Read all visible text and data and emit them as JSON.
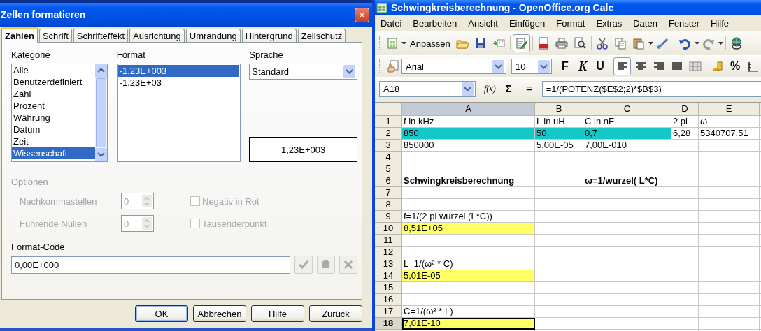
{
  "dialog": {
    "title": "Zellen formatieren",
    "tabs": [
      {
        "label": "Zahlen",
        "selected": true
      },
      {
        "label": "Schrift",
        "selected": false
      },
      {
        "label": "Schrifteffekt",
        "selected": false
      },
      {
        "label": "Ausrichtung",
        "selected": false
      },
      {
        "label": "Umrandung",
        "selected": false
      },
      {
        "label": "Hintergrund",
        "selected": false
      },
      {
        "label": "Zellschutz",
        "selected": false
      }
    ],
    "category": {
      "label": "Kategorie",
      "items": [
        {
          "label": "Alle",
          "selected": false
        },
        {
          "label": "Benutzerdefiniert",
          "selected": false
        },
        {
          "label": "Zahl",
          "selected": false
        },
        {
          "label": "Prozent",
          "selected": false
        },
        {
          "label": "Währung",
          "selected": false
        },
        {
          "label": "Datum",
          "selected": false
        },
        {
          "label": "Zeit",
          "selected": false
        },
        {
          "label": "Wissenschaft",
          "selected": true
        }
      ]
    },
    "format": {
      "label": "Format",
      "items": [
        {
          "label": "-1,23E+003",
          "selected": true
        },
        {
          "label": "-1,23E+03",
          "selected": false
        }
      ]
    },
    "language": {
      "label": "Sprache",
      "value": "Standard"
    },
    "preview": "1,23E+003",
    "options": {
      "label": "Optionen",
      "disabled": true,
      "fields": [
        {
          "label": "Nachkommastellen",
          "value": "0"
        },
        {
          "label": "Führende Nullen",
          "value": "0"
        }
      ],
      "checkboxes": [
        {
          "label": "Negativ in Rot",
          "checked": false
        },
        {
          "label": "Tausenderpunkt",
          "checked": false
        }
      ]
    },
    "format_code": {
      "label": "Format-Code",
      "value": "0,00E+000"
    },
    "buttons": [
      {
        "label": "OK",
        "default": true
      },
      {
        "label": "Abbrechen",
        "default": false
      },
      {
        "label": "Hilfe",
        "default": false
      },
      {
        "label": "Zurück",
        "default": false
      }
    ]
  },
  "calc": {
    "title": "Schwingkreisberechnung - OpenOffice.org Calc",
    "menu": [
      "Datei",
      "Bearbeiten",
      "Ansicht",
      "Einfügen",
      "Format",
      "Extras",
      "Daten",
      "Fenster",
      "Hilfe"
    ],
    "toolbar": {
      "customize_label": "Anpassen",
      "edit_mode_on": true
    },
    "format_toolbar": {
      "font": "Arial",
      "size": "10",
      "bold_label": "F",
      "italic_label": "K",
      "underline_label": "U",
      "align_options": [
        {
          "selected": true
        },
        {
          "selected": false
        },
        {
          "selected": false
        },
        {
          "selected": false
        }
      ],
      "percent_label": "%"
    },
    "formula_bar": {
      "cell_ref": "A18",
      "function_label": "f(x)",
      "sum_label": "Σ",
      "equals_label": "=",
      "formula": "=1/(POTENZ($E$2;2)*$B$3)"
    },
    "sheet": {
      "columns": [
        {
          "label": "A",
          "selected": true
        },
        {
          "label": "B",
          "selected": false
        },
        {
          "label": "C",
          "selected": false
        },
        {
          "label": "D",
          "selected": false
        },
        {
          "label": "E",
          "selected": false
        }
      ],
      "rows": [
        {
          "label": "1",
          "selected": false,
          "cells": [
            {
              "text": "f in kHz"
            },
            {
              "text": "L in uH"
            },
            {
              "text": "C in nF"
            },
            {
              "text": "2 pi"
            },
            {
              "text": "ω"
            }
          ]
        },
        {
          "label": "2",
          "selected": false,
          "cells": [
            {
              "text": "850",
              "color": "#14c8c8"
            },
            {
              "text": "50",
              "color": "#14c8c8"
            },
            {
              "text": "0,7",
              "color": "#14c8c8"
            },
            {
              "text": "6,28"
            },
            {
              "text": "5340707,51"
            }
          ]
        },
        {
          "label": "3",
          "selected": false,
          "cells": [
            {
              "text": "850000"
            },
            {
              "text": "5,00E-05"
            },
            {
              "text": "7,00E-010"
            }
          ]
        },
        {
          "label": "4",
          "selected": false,
          "cells": []
        },
        {
          "label": "5",
          "selected": false,
          "cells": []
        },
        {
          "label": "6",
          "selected": false,
          "cells": [
            {
              "text": "Schwingkreisberechnung",
              "bold": true
            },
            {},
            {
              "text": "ω=1/wurzel( L*C)",
              "bold": true
            }
          ]
        },
        {
          "label": "7",
          "selected": false,
          "cells": []
        },
        {
          "label": "8",
          "selected": false,
          "cells": []
        },
        {
          "label": "9",
          "selected": false,
          "cells": [
            {
              "text": "f=1/(2 pi wurzel (L*C))"
            }
          ]
        },
        {
          "label": "10",
          "selected": false,
          "cells": [
            {
              "text": "8,51E+05",
              "color": "#ffff66"
            }
          ]
        },
        {
          "label": "11",
          "selected": false,
          "cells": []
        },
        {
          "label": "12",
          "selected": false,
          "cells": []
        },
        {
          "label": "13",
          "selected": false,
          "cells": [
            {
              "text": "L=1/(ω² * C)"
            }
          ]
        },
        {
          "label": "14",
          "selected": false,
          "cells": [
            {
              "text": "5,01E-05",
              "color": "#ffff66"
            }
          ]
        },
        {
          "label": "15",
          "selected": false,
          "cells": []
        },
        {
          "label": "16",
          "selected": false,
          "cells": []
        },
        {
          "label": "17",
          "selected": false,
          "cells": [
            {
              "text": "C=1/(ω² * L)"
            }
          ]
        },
        {
          "label": "18",
          "selected": true,
          "cells": [
            {
              "text": "7,01E-10",
              "color": "#ffff66"
            }
          ]
        }
      ]
    }
  }
}
